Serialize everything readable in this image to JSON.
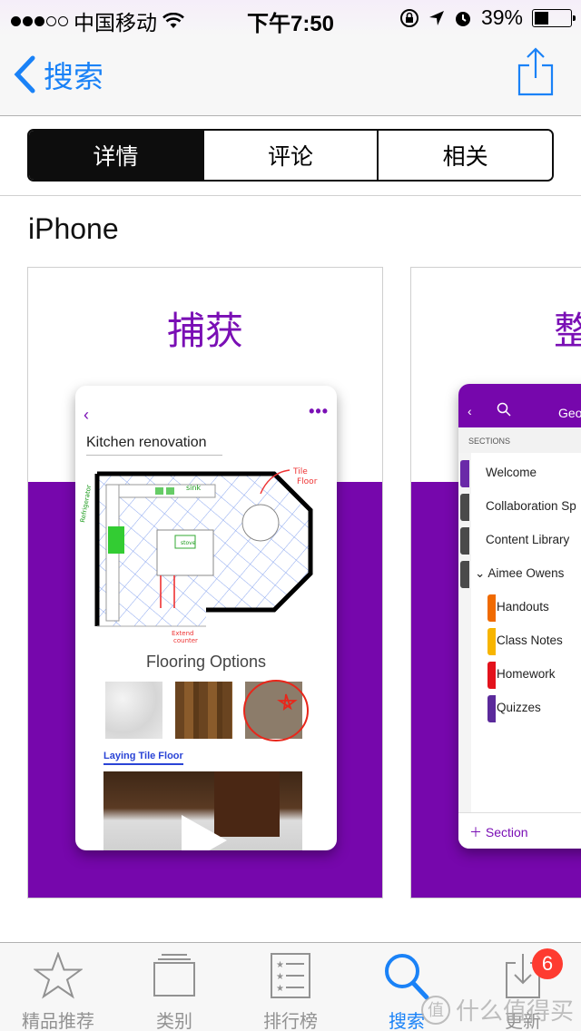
{
  "status_bar": {
    "signal_filled": 3,
    "signal_total": 5,
    "carrier": "中国移动",
    "time": "下午7:50",
    "battery_percent": "39%",
    "battery_level": 0.39
  },
  "nav": {
    "back_label": "搜索",
    "back_icon": "chevron-left-icon",
    "share_icon": "share-icon"
  },
  "segments": [
    {
      "label": "详情",
      "active": true
    },
    {
      "label": "评论",
      "active": false
    },
    {
      "label": "相关",
      "active": false
    }
  ],
  "section_title": "iPhone",
  "screenshots": [
    {
      "caption": "捕获",
      "page_title": "Kitchen renovation",
      "annotations": [
        "Tile Floor",
        "sink",
        "Refrigerator",
        "stove",
        "Extend counter"
      ],
      "heading": "Flooring Options",
      "link": "Laying Tile Floor"
    },
    {
      "caption": "整",
      "header_title": "Geo",
      "sections_label": "SECTIONS",
      "items": [
        {
          "label": "Welcome",
          "color": "#6a2aa8",
          "level": "top"
        },
        {
          "label": "Collaboration Sp",
          "color": "#4a4a4a",
          "level": "top"
        },
        {
          "label": "Content Library",
          "color": "#4a4a4a",
          "level": "top"
        },
        {
          "label": "Aimee Owens",
          "color": "#4a4a4a",
          "level": "group"
        },
        {
          "label": "Handouts",
          "color": "#f06a00",
          "level": "sub"
        },
        {
          "label": "Class Notes",
          "color": "#f7b500",
          "level": "sub"
        },
        {
          "label": "Homework",
          "color": "#e3121c",
          "level": "sub"
        },
        {
          "label": "Quizzes",
          "color": "#5b2a9b",
          "level": "sub"
        }
      ],
      "add_label": "Section"
    }
  ],
  "tab_bar": [
    {
      "label": "精品推荐",
      "icon": "star-icon",
      "active": false
    },
    {
      "label": "类别",
      "icon": "categories-icon",
      "active": false
    },
    {
      "label": "排行榜",
      "icon": "top-charts-icon",
      "active": false
    },
    {
      "label": "搜索",
      "icon": "search-icon",
      "active": true
    },
    {
      "label": "更新",
      "icon": "updates-icon",
      "active": false,
      "badge": "6"
    }
  ],
  "watermark": {
    "icon_char": "值",
    "text": "什么值得买"
  },
  "colors": {
    "ios_blue": "#1a82f7",
    "onenote_purple": "#7607ac",
    "badge_red": "#fe3b30"
  }
}
